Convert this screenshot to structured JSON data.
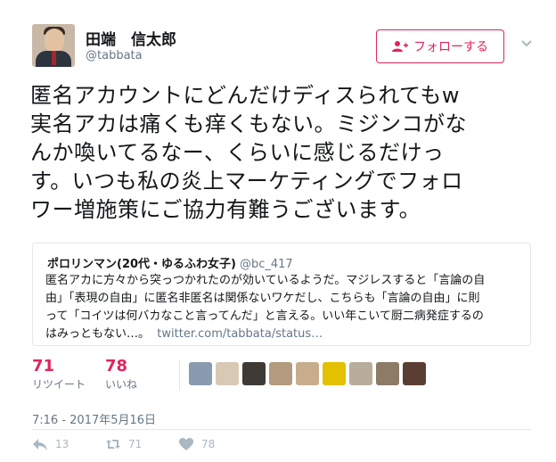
{
  "user": {
    "display_name": "田端　信太郎",
    "handle": "@tabbata"
  },
  "follow_button": {
    "label": "フォローする",
    "icon": "add-user-icon",
    "color": "#e0245e"
  },
  "menu_caret": {
    "icon": "chevron-down-icon"
  },
  "tweet": {
    "lines": [
      "匿名アカウントにどんだけディスられてもw",
      "実名アカは痛くも痒くもない。ミジンコがな",
      "んか喚いてるなー、くらいに感じるだけっ",
      "す。いつも私の炎上マーケティングでフォロ",
      "ワー増施策にご協力有難うございます。"
    ]
  },
  "quoted_tweet": {
    "name": "ポロリンマン(20代・ゆるふわ女子)",
    "handle": "@bc_417",
    "lines": [
      "匿名アカに方々から突っつかれたのが効いているようだ。マジレスすると「言論の自",
      "由」「表現の自由」に匿名非匿名は関係ないワケだし、こちらも「言論の自由」に則",
      "って「コイツは何バカなこと言ってんだ」と言える。いい年こいて厨二病発症するの",
      "はみっともない…。"
    ],
    "link": "twitter.com/tabbata/status…"
  },
  "stats": {
    "retweets": {
      "value": "71",
      "label": "リツイート"
    },
    "likes": {
      "value": "78",
      "label": "いいね"
    },
    "accent_color": "#e0245e"
  },
  "likers": [
    {
      "color": "#8a9bb0"
    },
    {
      "color": "#d9c9b4"
    },
    {
      "color": "#3f3a36"
    },
    {
      "color": "#b49a7e"
    },
    {
      "color": "#c8ad8c"
    },
    {
      "color": "#e3c000"
    },
    {
      "color": "#b8ad9a"
    },
    {
      "color": "#8d7b66"
    },
    {
      "color": "#5a3e34"
    }
  ],
  "timestamp": "7:16 - 2017年5月16日",
  "actions": {
    "reply": {
      "count": "13",
      "icon": "reply-icon"
    },
    "retweet": {
      "count": "71",
      "icon": "retweet-icon"
    },
    "like": {
      "count": "78",
      "icon": "heart-icon"
    }
  }
}
